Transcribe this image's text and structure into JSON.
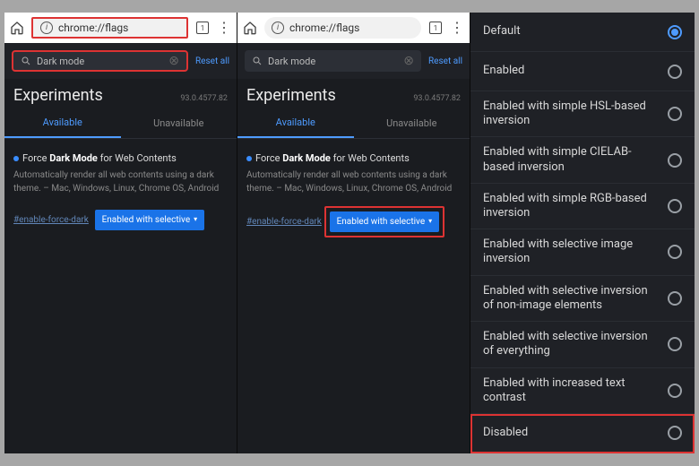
{
  "browser": {
    "url": "chrome://flags",
    "tab_count": "1"
  },
  "search": {
    "value": "Dark mode",
    "reset_label": "Reset all"
  },
  "experiments": {
    "title": "Experiments",
    "version": "93.0.4577.82"
  },
  "tabs": {
    "available": "Available",
    "unavailable": "Unavailable"
  },
  "feature": {
    "title_prefix": "Force ",
    "title_bold": "Dark Mode",
    "title_suffix": " for Web Contents",
    "desc": "Automatically render all web contents using a dark theme. – Mac, Windows, Linux, Chrome OS, Android",
    "hash": "#enable-force-dark",
    "selected": "Enabled with selective"
  },
  "options": [
    {
      "label": "Default",
      "selected": true
    },
    {
      "label": "Enabled",
      "selected": false
    },
    {
      "label": "Enabled with simple HSL-based inversion",
      "selected": false
    },
    {
      "label": "Enabled with simple CIELAB-based inversion",
      "selected": false
    },
    {
      "label": "Enabled with simple RGB-based inversion",
      "selected": false
    },
    {
      "label": "Enabled with selective image inversion",
      "selected": false
    },
    {
      "label": "Enabled with selective inversion of non-image elements",
      "selected": false
    },
    {
      "label": "Enabled with selective inversion of everything",
      "selected": false
    },
    {
      "label": "Enabled with increased text contrast",
      "selected": false
    },
    {
      "label": "Disabled",
      "selected": false,
      "highlight": true
    }
  ]
}
